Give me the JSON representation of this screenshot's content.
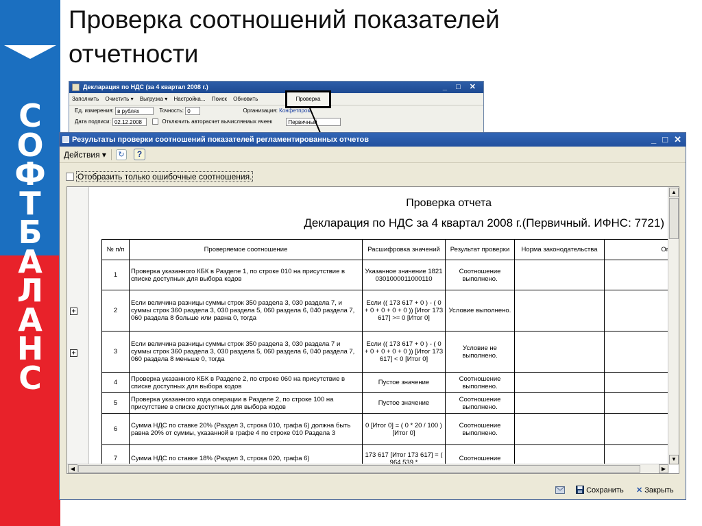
{
  "brand": {
    "letters": [
      "С",
      "О",
      "Ф",
      "Т",
      "Б",
      "А",
      "Л",
      "А",
      "Н",
      "С"
    ],
    "colors": {
      "top": "#1b6fc0",
      "bottom": "#e8222a"
    }
  },
  "slide": {
    "title_line1": "Проверка соотношений показателей",
    "title_line2": "отчетности"
  },
  "background_window": {
    "title": "Декларация по НДС (за 4 квартал 2008 г.)",
    "toolbar": [
      "Заполнить",
      "Очистить ▾",
      "Выгрузка ▾",
      "Настройка...",
      "Поиск",
      "Обновить"
    ],
    "check_button": "Проверка",
    "unit_label": "Ед. измерения:",
    "unit_value": "в рублях",
    "precision_label": "Точность:",
    "precision_value": "0",
    "org_label": "Организация:",
    "org_value": "Конфетпром",
    "sign_date_label": "Дата подписи:",
    "sign_date_value": "02.12.2008",
    "autocalc_label": "Отключить авторасчет вычисляемых ячеек",
    "type_value": "Первичный"
  },
  "main_window": {
    "title": "Результаты проверки соотношений показателей регламентированных отчетов",
    "actions_label": "Действия ▾",
    "help_label": "?",
    "errors_only_label": "Отобразить только ошибочные соотношения.",
    "report_title": "Проверка отчета",
    "report_subtitle": "Декларация по НДС за 4 квартал 2008 г.(Первичный. ИФНС: 7721)",
    "columns": [
      "№ п/п",
      "Проверяемое соотношение",
      "Расшифровка значений",
      "Результат проверки",
      "Норма законодательства",
      "Описание н"
    ],
    "rows": [
      {
        "num": "1",
        "relation": "Проверка указанного КБК в Разделе 1, по строке 010 на присутствие в списке доступных для выбора кодов",
        "values": "Указанное значение 18210301000011000110",
        "result": "Соотношение выполнено."
      },
      {
        "num": "2",
        "relation": "Если величина разницы суммы строк 350 раздела 3, 030 раздела 7, и суммы строк 360 раздела 3, 030 раздела 5, 060 раздела 6, 040 раздела 7, 060 раздела 8 больше или равна 0, тогда",
        "values": "Если (( 173 617 + 0 ) - ( 0 + 0 + 0 + 0 + 0 )) [Итог 173 617] >= 0 [Итог 0]",
        "result": "Условие выполнено."
      },
      {
        "num": "3",
        "relation": "Если величина разницы суммы строк 350 раздела 3, 030 раздела 7 и суммы строк 360 раздела 3, 030 раздела 5, 060 раздела 6, 040 раздела 7, 060 раздела 8 меньше 0, тогда",
        "values": "Если (( 173 617 + 0 ) - ( 0 + 0 + 0 + 0 + 0 )) [Итог 173 617] < 0 [Итог 0]",
        "result": "Условие не выполнено."
      },
      {
        "num": "4",
        "relation": "Проверка указанного КБК в Разделе 2, по строке 060 на присутствие в списке доступных для выбора кодов",
        "values": "Пустое значение",
        "result": "Соотношение выполнено."
      },
      {
        "num": "5",
        "relation": "Проверка указанного кода операции в Разделе 2, по строке 100 на присутствие в списке доступных для выбора кодов",
        "values": "Пустое значение",
        "result": "Соотношение выполнено."
      },
      {
        "num": "6",
        "relation": "Сумма НДС по ставке 20% (Раздел 3, строка 010, графа 6) должна быть равна 20% от суммы, указанной в графе 4 по строке 010 Раздела 3",
        "values": "0 [Итог 0] = ( 0 * 20 / 100 ) [Итог 0]",
        "result": "Соотношение выполнено."
      },
      {
        "num": "7",
        "relation": "Сумма НДС по ставке 18% (Раздел 3, строка 020, графа 6)",
        "values": "173 617 [Итог 173 617] = ( 964 539 *",
        "result": "Соотношение"
      }
    ],
    "save_label": "Сохранить",
    "close_label": "Закрыть"
  }
}
